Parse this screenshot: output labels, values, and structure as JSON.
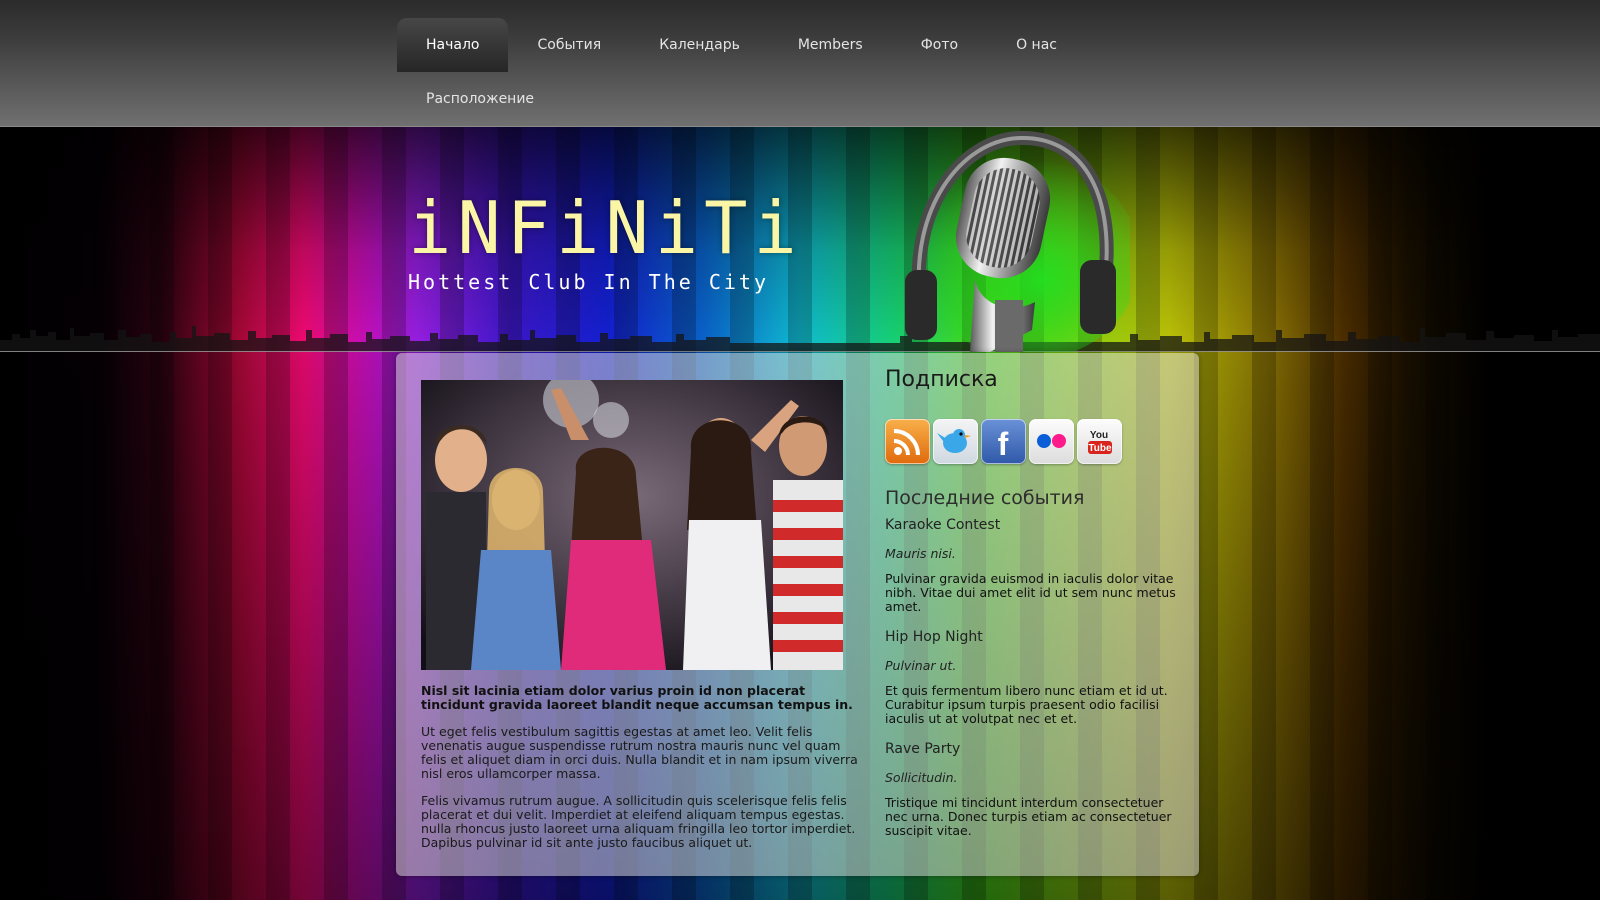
{
  "nav": {
    "items": [
      "Начало",
      "События",
      "Календарь",
      "Members",
      "Фото",
      "О нас"
    ],
    "items2": [
      "Расположение"
    ],
    "active": "Начало"
  },
  "hero": {
    "title": "iNFiNiTi",
    "subtitle": "Hottest Club In The City"
  },
  "main": {
    "intro": "Nisl sit lacinia etiam dolor varius proin id non placerat tincidunt gravida laoreet blandit neque accumsan tempus in.",
    "paragraphs": [
      "Ut eget felis vestibulum sagittis egestas at amet leo. Velit felis venenatis augue suspendisse rutrum nostra mauris nunc vel quam felis et aliquet diam in orci duis. Nulla blandit et in nam ipsum viverra nisl eros ullamcorper massa.",
      "Felis vivamus rutrum augue. A sollicitudin quis scelerisque felis felis placerat et dui velit. Imperdiet at eleifend aliquam tempus egestas. nulla rhoncus justo laoreet urna aliquam fringilla leo tortor imperdiet. Dapibus pulvinar id sit ante justo faucibus aliquet ut."
    ]
  },
  "sidebar": {
    "subscribe_title": "Подписка",
    "social": [
      "rss-icon",
      "twitter-icon",
      "facebook-icon",
      "flickr-icon",
      "youtube-icon"
    ],
    "youtube_label": "You Tube",
    "facebook_label": "f",
    "events_title": "Последние события",
    "events": [
      {
        "title": "Karaoke Contest",
        "date": "Mauris nisi.",
        "text": "Pulvinar gravida euismod in iaculis dolor vitae nibh. Vitae dui amet elit id ut sem nunc metus amet."
      },
      {
        "title": "Hip Hop Night",
        "date": "Pulvinar ut.",
        "text": "Et quis fermentum libero nunc etiam et id ut. Curabitur ipsum turpis praesent odio facilisi iaculis ut at volutpat nec et et."
      },
      {
        "title": "Rave Party",
        "date": "Sollicitudin.",
        "text": "Tristique mi tincidunt interdum consectetuer nec urna. Donec turpis etiam ac consectetuer suscipit vitae."
      }
    ]
  },
  "colors": {
    "title": "#fbf6a6",
    "accent_rss": "#f08a1c",
    "accent_facebook": "#3b67b8",
    "accent_youtube": "#d8241c"
  }
}
